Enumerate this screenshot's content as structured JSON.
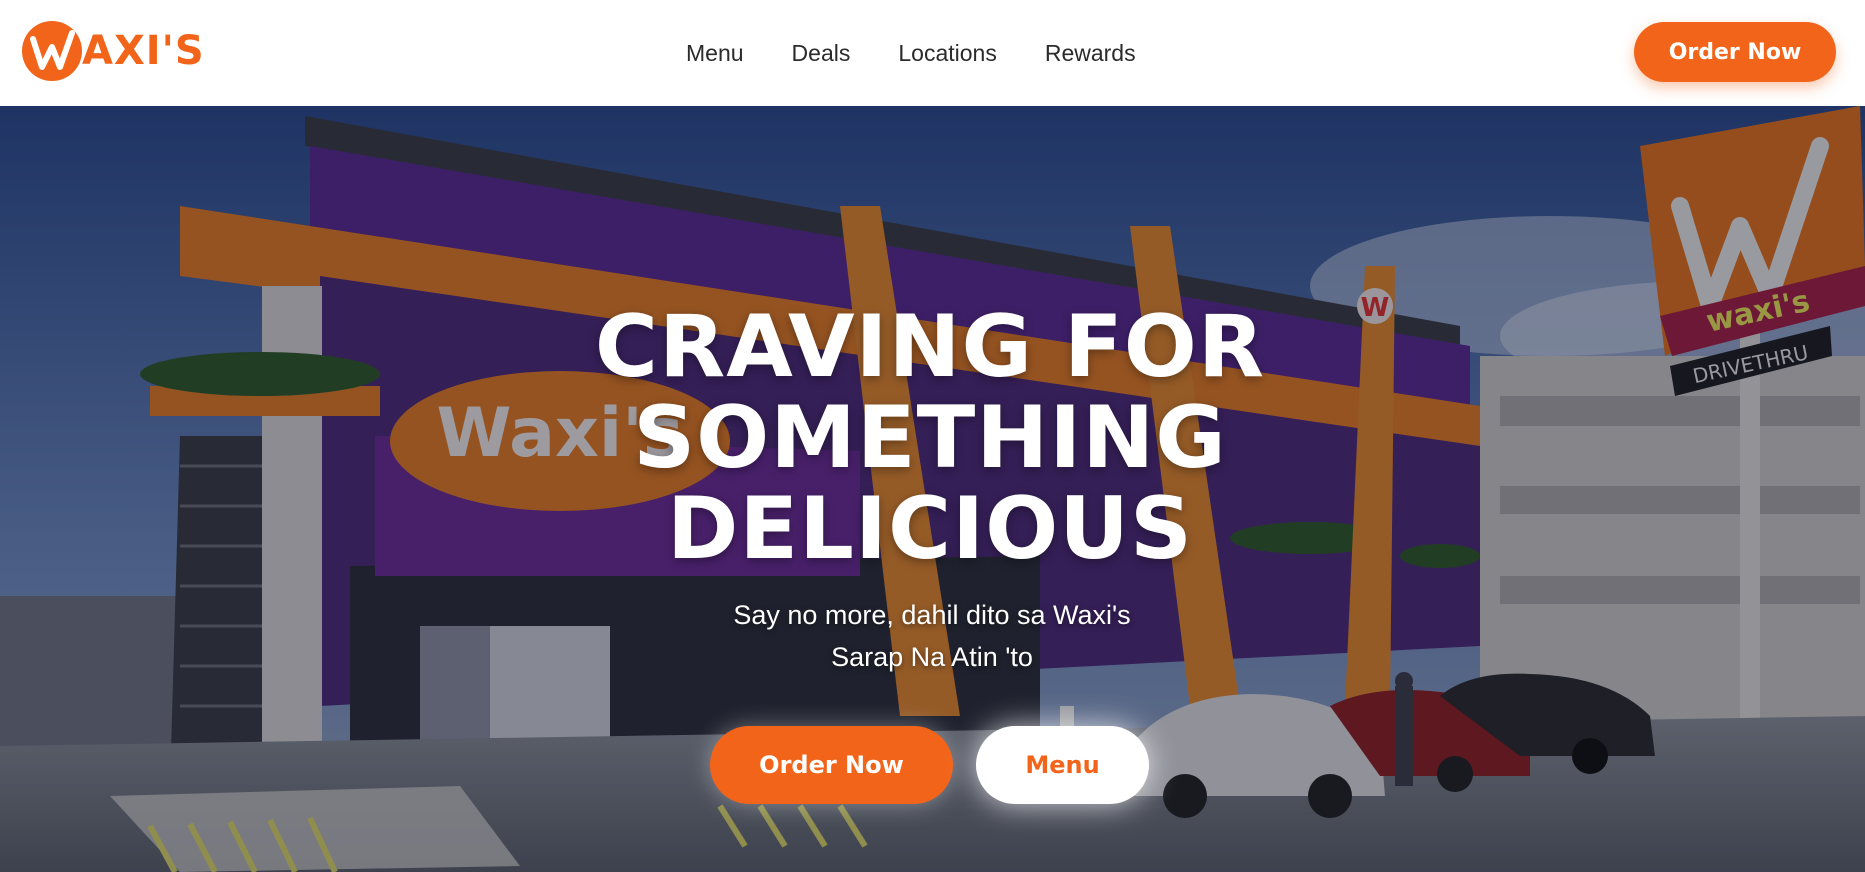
{
  "brand": {
    "logo_text": "AXI'S",
    "accent_color": "#f26419"
  },
  "nav": {
    "items": [
      "Menu",
      "Deals",
      "Locations",
      "Rewards"
    ]
  },
  "header": {
    "cta_label": "Order Now"
  },
  "hero": {
    "headline_lines": [
      "CRAVING FOR",
      "SOMETHING",
      "DELICIOUS"
    ],
    "subtitle_lines": [
      "Say no more, dahil dito sa Waxi's",
      "Sarap Na Atin 'to"
    ],
    "primary_button": "Order Now",
    "secondary_button": "Menu",
    "background_image": "waxis-drive-thru-store-rendering",
    "storefront_sign": "Waxi's",
    "pole_sign_lines": [
      "waxi's",
      "DRIVETHRU"
    ]
  }
}
